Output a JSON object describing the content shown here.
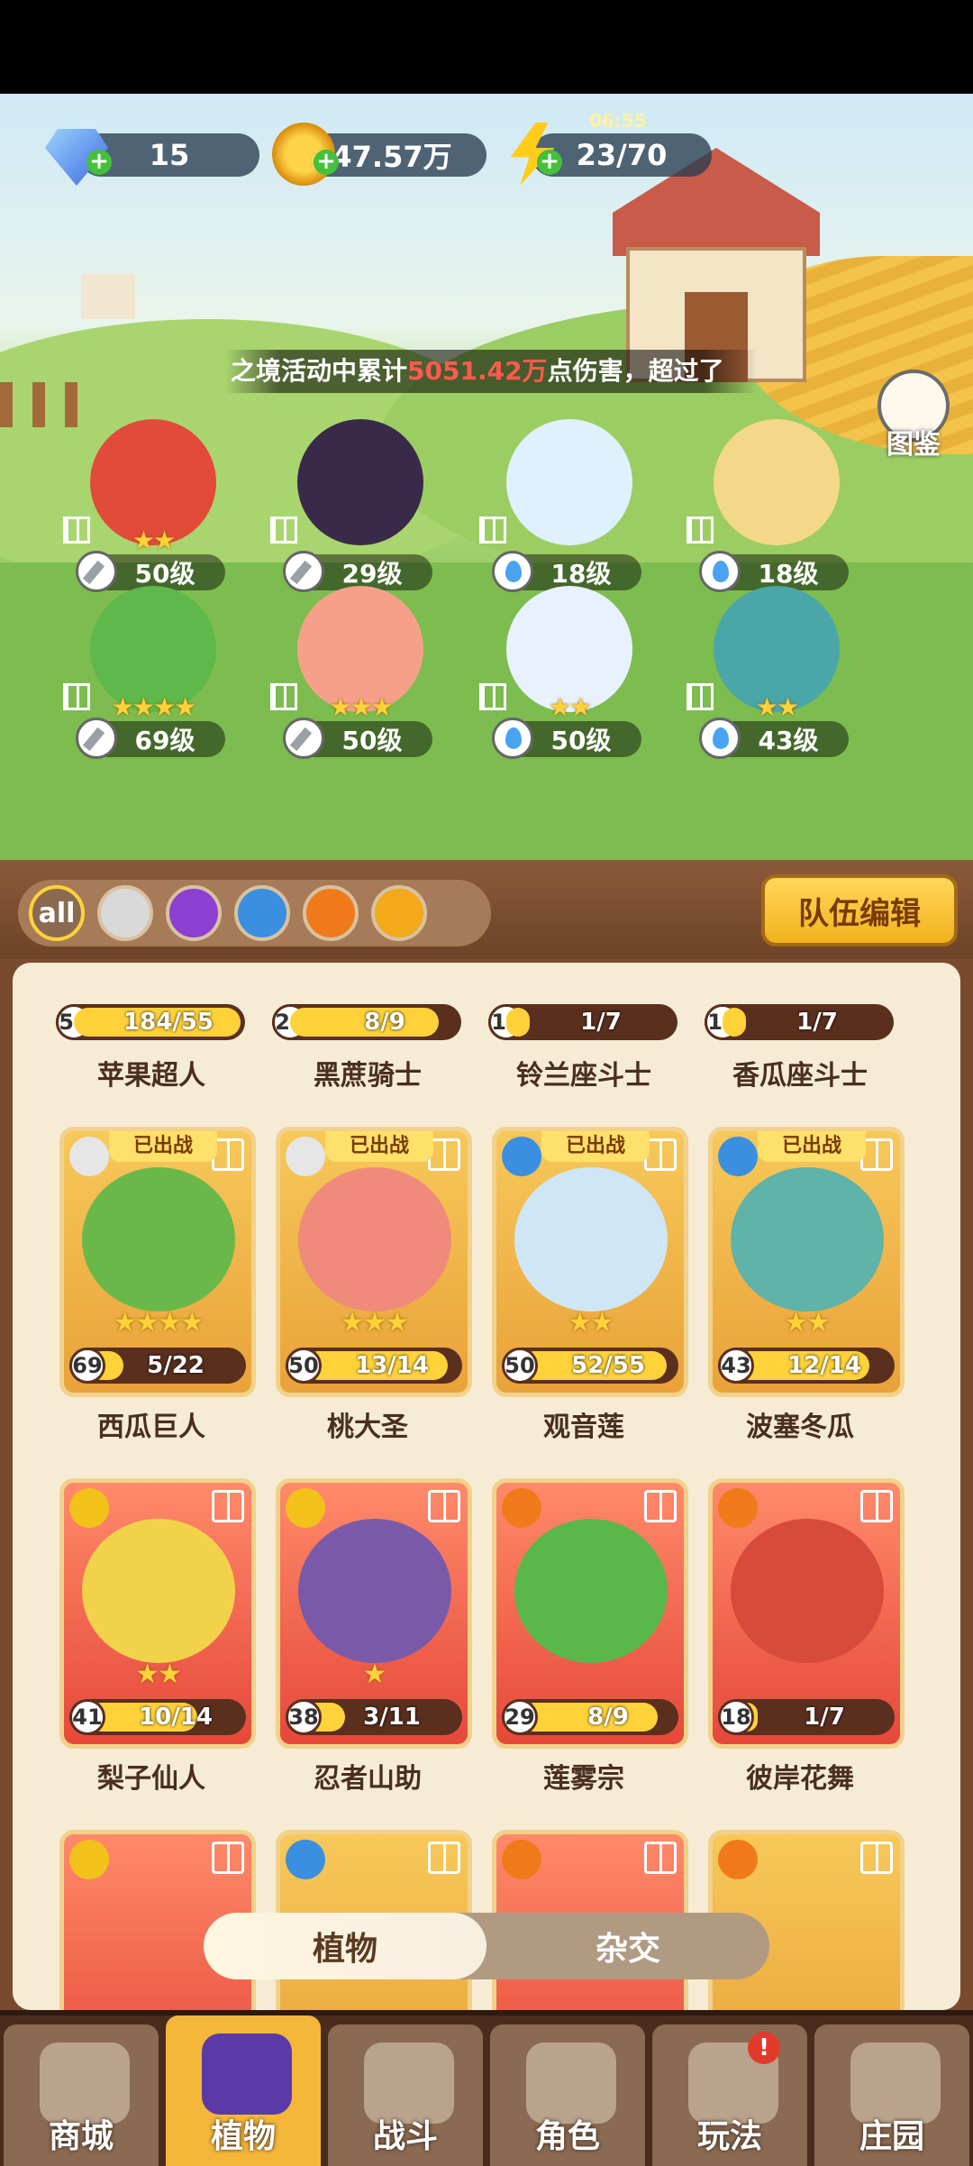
{
  "resources": {
    "gems": "15",
    "gold": "47.57万",
    "energy": "23/70",
    "timer": "06:55"
  },
  "banner": {
    "prefix": "之境活动中累计",
    "highlight": "5051.42万",
    "suffix": "点伤害，超过了"
  },
  "codex_label": "图鉴",
  "team": [
    {
      "element": "sword",
      "level": "50级",
      "stars": "★★"
    },
    {
      "element": "sword",
      "level": "29级",
      "stars": ""
    },
    {
      "element": "water",
      "level": "18级",
      "stars": ""
    },
    {
      "element": "water",
      "level": "18级",
      "stars": ""
    },
    {
      "element": "sword",
      "level": "69级",
      "stars": "★★★★"
    },
    {
      "element": "sword",
      "level": "50级",
      "stars": "★★★"
    },
    {
      "element": "water",
      "level": "50级",
      "stars": "★★"
    },
    {
      "element": "water",
      "level": "43级",
      "stars": "★★"
    }
  ],
  "filters": [
    "all",
    "sword",
    "potion",
    "water",
    "fire",
    "light"
  ],
  "team_edit_label": "队伍编辑",
  "row0": [
    {
      "level": "50",
      "progress": "184/55",
      "fill": 1.0,
      "name": "苹果超人"
    },
    {
      "level": "29",
      "progress": "8/9",
      "fill": 0.89,
      "name": "黑蔗骑士"
    },
    {
      "level": "18",
      "progress": "1/7",
      "fill": 0.14,
      "name": "铃兰座斗士"
    },
    {
      "level": "18",
      "progress": "1/7",
      "fill": 0.14,
      "name": "香瓜座斗士"
    }
  ],
  "row1": [
    {
      "badge": "已出战",
      "element": "sword",
      "stars": "★★★★",
      "level": "69",
      "progress": "5/22",
      "fill": 0.23,
      "name": "西瓜巨人",
      "color": "#6bb84a"
    },
    {
      "badge": "已出战",
      "element": "sword",
      "stars": "★★★",
      "level": "50",
      "progress": "13/14",
      "fill": 0.93,
      "name": "桃大圣",
      "color": "#f08a7a"
    },
    {
      "badge": "已出战",
      "element": "water",
      "stars": "★★",
      "level": "50",
      "progress": "52/55",
      "fill": 0.95,
      "name": "观音莲",
      "color": "#cfe6f6"
    },
    {
      "badge": "已出战",
      "element": "water",
      "stars": "★★",
      "level": "43",
      "progress": "12/14",
      "fill": 0.86,
      "name": "波塞冬瓜",
      "color": "#5fb3a8"
    }
  ],
  "row2": [
    {
      "element": "light",
      "stars": "★★",
      "level": "41",
      "progress": "10/14",
      "fill": 0.71,
      "name": "梨子仙人",
      "color": "#f2d24a"
    },
    {
      "element": "light",
      "stars": "★",
      "level": "38",
      "progress": "3/11",
      "fill": 0.27,
      "name": "忍者山助",
      "color": "#7a5aa8"
    },
    {
      "element": "fire",
      "stars": "",
      "level": "29",
      "progress": "8/9",
      "fill": 0.89,
      "name": "莲雾宗",
      "color": "#5ab84a"
    },
    {
      "element": "fire",
      "stars": "",
      "level": "18",
      "progress": "1/7",
      "fill": 0.14,
      "name": "彼岸花舞",
      "color": "#d84a3a"
    }
  ],
  "toggle": {
    "left": "植物",
    "right": "杂交"
  },
  "nav": [
    {
      "label": "商城",
      "active": false
    },
    {
      "label": "植物",
      "active": true
    },
    {
      "label": "战斗",
      "active": false
    },
    {
      "label": "角色",
      "active": false
    },
    {
      "label": "玩法",
      "active": false,
      "badge": "!"
    },
    {
      "label": "庄园",
      "active": false
    }
  ]
}
